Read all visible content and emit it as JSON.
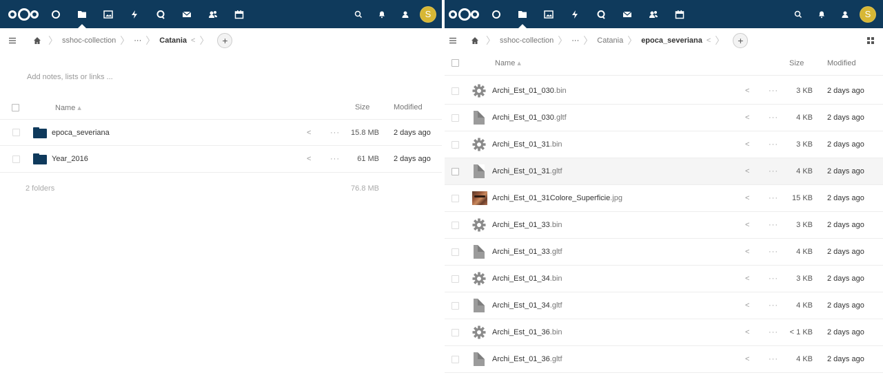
{
  "left": {
    "breadcrumb": [
      "sshoc-collection",
      "···",
      "Catania"
    ],
    "notes_placeholder": "Add notes, lists or links ...",
    "header": {
      "name": "Name",
      "size": "Size",
      "modified": "Modified"
    },
    "rows": [
      {
        "name": "epoca_severiana",
        "size": "15.8 MB",
        "modified": "2 days ago"
      },
      {
        "name": "Year_2016",
        "size": "61 MB",
        "modified": "2 days ago"
      }
    ],
    "summary": {
      "count": "2 folders",
      "size": "76.8 MB"
    }
  },
  "right": {
    "breadcrumb": [
      "sshoc-collection",
      "···",
      "Catania",
      "epoca_severiana"
    ],
    "header": {
      "name": "Name",
      "size": "Size",
      "modified": "Modified"
    },
    "rows": [
      {
        "base": "Archi_Est_01_030",
        "ext": ".bin",
        "icon": "gear-icon",
        "size": "3 KB",
        "modified": "2 days ago"
      },
      {
        "base": "Archi_Est_01_030",
        "ext": ".gltf",
        "icon": "file-icon",
        "size": "4 KB",
        "modified": "2 days ago"
      },
      {
        "base": "Archi_Est_01_31",
        "ext": ".bin",
        "icon": "gear-icon",
        "size": "3 KB",
        "modified": "2 days ago"
      },
      {
        "base": "Archi_Est_01_31",
        "ext": ".gltf",
        "icon": "file-icon",
        "size": "4 KB",
        "modified": "2 days ago"
      },
      {
        "base": "Archi_Est_01_31Colore_Superficie",
        "ext": ".jpg",
        "icon": "image-thumbnail-icon",
        "size": "15 KB",
        "modified": "2 days ago"
      },
      {
        "base": "Archi_Est_01_33",
        "ext": ".bin",
        "icon": "gear-icon",
        "size": "3 KB",
        "modified": "2 days ago"
      },
      {
        "base": "Archi_Est_01_33",
        "ext": ".gltf",
        "icon": "file-icon",
        "size": "4 KB",
        "modified": "2 days ago"
      },
      {
        "base": "Archi_Est_01_34",
        "ext": ".bin",
        "icon": "gear-icon",
        "size": "3 KB",
        "modified": "2 days ago"
      },
      {
        "base": "Archi_Est_01_34",
        "ext": ".gltf",
        "icon": "file-icon",
        "size": "4 KB",
        "modified": "2 days ago"
      },
      {
        "base": "Archi_Est_01_36",
        "ext": ".bin",
        "icon": "gear-icon",
        "size": "< 1 KB",
        "modified": "2 days ago"
      },
      {
        "base": "Archi_Est_01_36",
        "ext": ".gltf",
        "icon": "file-icon",
        "size": "4 KB",
        "modified": "2 days ago"
      }
    ]
  },
  "avatar_letter": "S",
  "colors": {
    "header": "#0f3a5c",
    "avatar": "#d7b735"
  }
}
